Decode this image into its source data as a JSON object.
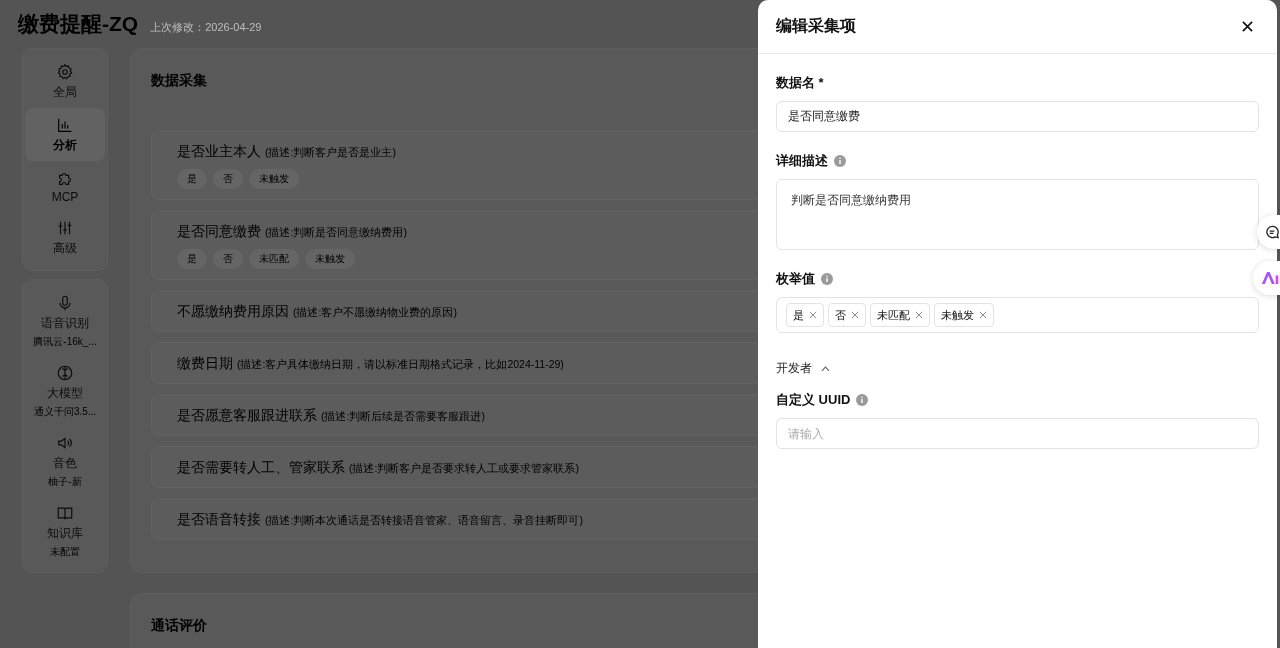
{
  "header": {
    "title": "缴费提醒-ZQ",
    "modified": "上次修改：2026-04-29"
  },
  "sidebar": {
    "groups": [
      {
        "items": [
          {
            "label": "全局",
            "selected": false
          },
          {
            "label": "分析",
            "selected": true
          },
          {
            "label": "MCP",
            "selected": false
          },
          {
            "label": "高级",
            "selected": false
          }
        ]
      },
      {
        "items": [
          {
            "label": "语音识别",
            "sublabel": "腾讯云-16k_...",
            "selected": false
          },
          {
            "label": "大模型",
            "sublabel": "通义千问3.5...",
            "selected": false
          },
          {
            "label": "音色",
            "sublabel": "柚子-新",
            "selected": false
          },
          {
            "label": "知识库",
            "sublabel": "未配置",
            "selected": false
          }
        ]
      }
    ]
  },
  "data_collection": {
    "title": "数据采集",
    "items": [
      {
        "name": "是否业主本人",
        "description": "(描述:判断客户是否是业主)",
        "tags": [
          "是",
          "否",
          "未触发"
        ]
      },
      {
        "name": "是否同意缴费",
        "description": "(描述:判断是否同意缴纳费用)",
        "tags": [
          "是",
          "否",
          "未匹配",
          "未触发"
        ]
      },
      {
        "name": "不愿缴纳费用原因",
        "description": "(描述:客户不愿缴纳物业费的原因)"
      },
      {
        "name": "缴费日期",
        "description": "(描述:客户具体缴纳日期，请以标准日期格式记录，比如2024-11-29)"
      },
      {
        "name": "是否愿意客服跟进联系",
        "description": "(描述:判断后续是否需要客服跟进)"
      },
      {
        "name": "是否需要转人工、管家联系",
        "description": "(描述:判断客户是否要求转人工或要求管家联系)"
      },
      {
        "name": "是否语音转接",
        "description": "(描述:判断本次通话是否转接语音管家、语音留言、录音挂断即可)"
      }
    ]
  },
  "call_evaluation": {
    "title": "通话评价"
  },
  "drawer": {
    "title": "编辑采集项",
    "name_field": {
      "label": "数据名 *",
      "value": "是否同意缴费"
    },
    "description_field": {
      "label": "详细描述",
      "value": "判断是否同意缴纳费用"
    },
    "enum_field": {
      "label": "枚举值",
      "tags": [
        "是",
        "否",
        "未匹配",
        "未触发"
      ]
    },
    "developer": {
      "label": "开发者",
      "expanded": true
    },
    "uuid_field": {
      "label": "自定义 UUID",
      "placeholder": "请输入"
    }
  }
}
